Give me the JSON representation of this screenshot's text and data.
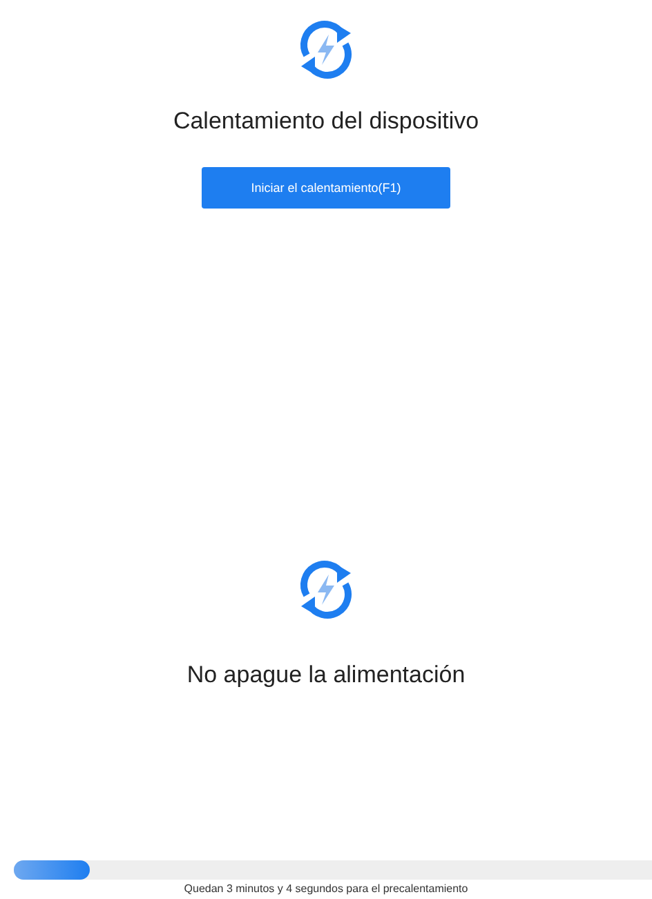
{
  "header": {
    "title": "Calentamiento del dispositivo",
    "button": "Iniciar el calentamiento(F1)"
  },
  "status": {
    "message": "No apague la alimentación"
  },
  "progress": {
    "level": 0.12,
    "caption": "Quedan 3 minutos y 4 segundos para el precalentamiento"
  }
}
